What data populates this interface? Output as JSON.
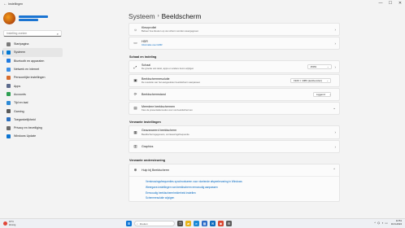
{
  "window": {
    "title": "Instellingen",
    "controls": {
      "minimize": "—",
      "maximize": "☐",
      "close": "✕"
    }
  },
  "sidebar": {
    "search_placeholder": "Instelling zoeken",
    "items": [
      {
        "label": "Startpagina",
        "color": "#7a7a7a"
      },
      {
        "label": "Systeem",
        "color": "#0078d4",
        "active": true
      },
      {
        "label": "Bluetooth en apparaten",
        "color": "#1f7ae0"
      },
      {
        "label": "Netwerk en internet",
        "color": "#3a8ee6"
      },
      {
        "label": "Persoonlijke instellingen",
        "color": "#d76b2c"
      },
      {
        "label": "Apps",
        "color": "#5b6a8c"
      },
      {
        "label": "Accounts",
        "color": "#2e9f52"
      },
      {
        "label": "Tijd en taal",
        "color": "#2d8ad6"
      },
      {
        "label": "Gaming",
        "color": "#5a5a5a"
      },
      {
        "label": "Toegankelijkheid",
        "color": "#2c6fbf"
      },
      {
        "label": "Privacy en beveiliging",
        "color": "#6a6a6a"
      },
      {
        "label": "Windows Update",
        "color": "#0a73d1"
      }
    ]
  },
  "main": {
    "breadcrumb": {
      "parent": "Systeem",
      "separator": "›",
      "current": "Beeldscherm"
    },
    "top_cards": [
      {
        "icon": "☼",
        "title": "Kleurprofiel",
        "subtitle": "Beheer hoe kleuren op uw scherm worden weergegeven"
      },
      {
        "icon": "▭",
        "title": "HDR",
        "subtitle": "Informatie over HDR"
      }
    ],
    "scale_section": "Schaal en indeling",
    "scale_cards": [
      {
        "icon": "⤢",
        "title": "Schaal",
        "subtitle": "De grootte van tekst, apps en andere items wijzigen",
        "value": "150%"
      },
      {
        "icon": "▣",
        "title": "Beeldschermresolutie",
        "subtitle": "De resolutie van het aangesloten beeldscherm aanpassen",
        "value": "1920 × 1080 (aanbevolen)"
      },
      {
        "icon": "⟳",
        "title": "Beeldschermstand",
        "subtitle": "",
        "value": "Liggend"
      },
      {
        "icon": "▤",
        "title": "Meerdere beeldschermen",
        "subtitle": "Kies de presentatiemodus voor uw beeldschermen"
      }
    ],
    "related_section": "Verwante instellingen",
    "related_cards": [
      {
        "icon": "▦",
        "title": "Geavanceerd beeldscherm",
        "subtitle": "Beeldschermgegevens, vernieuwingsfrequentie"
      },
      {
        "icon": "▥",
        "title": "Graphics",
        "subtitle": ""
      }
    ],
    "support_section": "Verwante ondersteuning",
    "help": {
      "icon": "⊕",
      "title": "Hulp bij Beeldscherm",
      "links": [
        "Vernieuwingsfrequenties synchroniseren voor vloeiende afspeelervaring in Windows",
        "Weergave-instellingen van beeldscherm eenvoudig aanpassen",
        "Eenvoudig beeldschermhelderheid instellen",
        "Schermresolutie wijzigen"
      ]
    }
  },
  "taskbar": {
    "weather": {
      "temp": "15°C",
      "desc": "Zonnig"
    },
    "search_placeholder": "Zoeken",
    "apps": [
      {
        "name": "start",
        "color": "#0a74d6",
        "glyph": "⊞"
      },
      {
        "name": "task-view",
        "color": "#4a4a4a",
        "glyph": "❐"
      },
      {
        "name": "file-explorer",
        "color": "#e7b51d",
        "glyph": "▰"
      },
      {
        "name": "edge",
        "color": "#1a8ad6",
        "glyph": "e"
      },
      {
        "name": "store",
        "color": "#2b6ac7",
        "glyph": "▦"
      },
      {
        "name": "mail",
        "color": "#0f6cbd",
        "glyph": "✉"
      },
      {
        "name": "chrome",
        "color": "#d9452f",
        "glyph": "◉"
      },
      {
        "name": "settings",
        "color": "#5c5c5c",
        "glyph": "⚙"
      }
    ],
    "tray": {
      "chevron": "^",
      "network": "⌬",
      "volume": "◖",
      "battery": "▭"
    },
    "clock": {
      "time": "12:51",
      "date": "16-6-2024"
    }
  }
}
